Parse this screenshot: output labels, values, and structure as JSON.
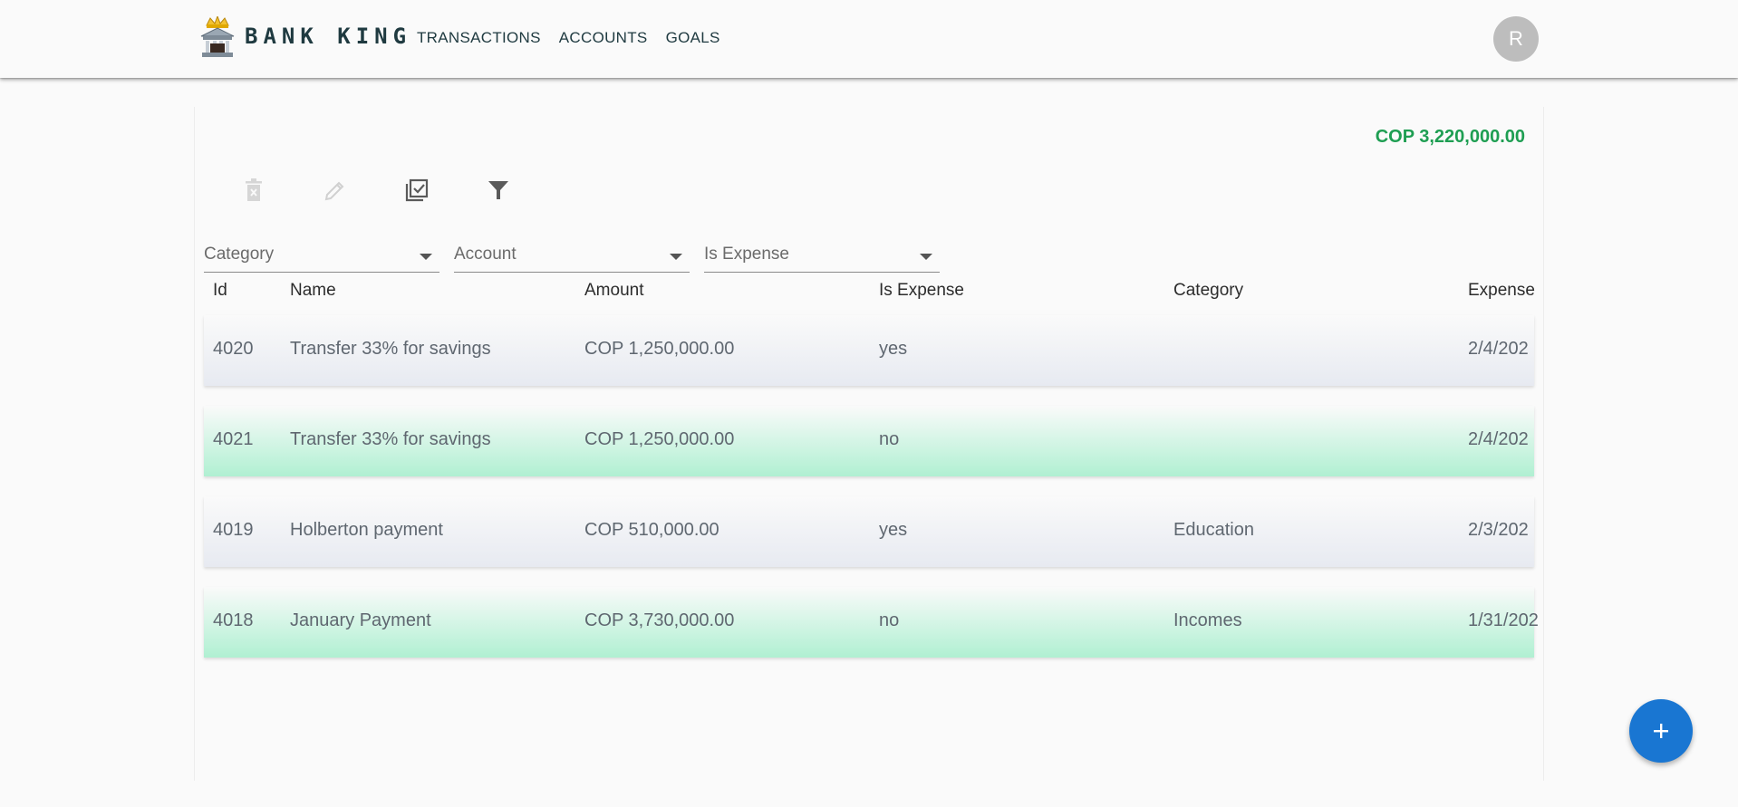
{
  "app": {
    "brand": "BANK KING"
  },
  "nav": [
    "TRANSACTIONS",
    "ACCOUNTS",
    "GOALS"
  ],
  "user": {
    "avatar_initial": "R"
  },
  "summary": {
    "balance": "COP 3,220,000.00",
    "balance_color": "#1e9e52"
  },
  "toolbar": {
    "icons": [
      "delete-icon",
      "edit-icon",
      "select-all-icon",
      "filter-icon"
    ],
    "delete_enabled": false,
    "edit_enabled": false
  },
  "filters": {
    "category": "Category",
    "account": "Account",
    "is_expense": "Is Expense"
  },
  "table": {
    "headers": {
      "id": "Id",
      "name": "Name",
      "amount": "Amount",
      "is_expense": "Is Expense",
      "category": "Category",
      "expense": "Expense"
    },
    "rows": [
      {
        "id": "4020",
        "name": "Transfer 33% for savings",
        "amount": "COP 1,250,000.00",
        "is_expense": "yes",
        "category": "",
        "date": "2/4/202"
      },
      {
        "id": "4021",
        "name": "Transfer 33% for savings",
        "amount": "COP 1,250,000.00",
        "is_expense": "no",
        "category": "",
        "date": "2/4/202"
      },
      {
        "id": "4019",
        "name": "Holberton payment",
        "amount": "COP 510,000.00",
        "is_expense": "yes",
        "category": "Education",
        "date": "2/3/202"
      },
      {
        "id": "4018",
        "name": "January Payment",
        "amount": "COP 3,730,000.00",
        "is_expense": "no",
        "category": "Incomes",
        "date": "1/31/202"
      }
    ]
  },
  "fab": {
    "icon": "plus-icon",
    "color": "#1976d2"
  }
}
